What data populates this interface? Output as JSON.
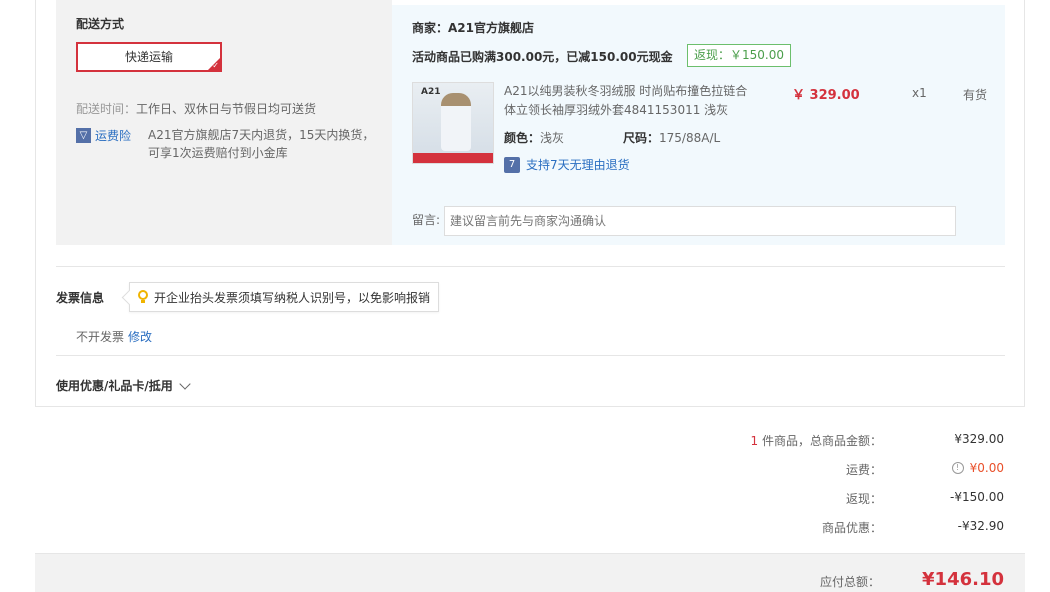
{
  "delivery": {
    "title": "配送方式",
    "method": "快递运输",
    "time_label": "配送时间：",
    "time_value": "工作日、双休日与节假日均可送货",
    "insurance_label": "运费险",
    "insurance_desc": "A21官方旗舰店7天内退货，15天内换货，可享1次运费赔付到小金库"
  },
  "shop": {
    "merchant": "商家：A21官方旗舰店",
    "promo": "活动商品已购满300.00元，已减150.00元现金",
    "rebate_badge": "返现：￥150.00",
    "product": {
      "thumb_brand": "A21",
      "title": "A21以纯男装秋冬羽绒服 时尚贴布撞色拉链合体立领长袖厚羽绒外套4841153011 浅灰",
      "price": "￥ 329.00",
      "qty": "x1",
      "stock": "有货",
      "color_label": "颜色：",
      "color_value": "浅灰",
      "size_label": "尺码：",
      "size_value": "175/88A/L",
      "return_icon": "7",
      "return_text": "支持7天无理由退货"
    },
    "note_label": "留言:",
    "note_placeholder": "建议留言前先与商家沟通确认"
  },
  "invoice": {
    "title": "发票信息",
    "tip": "开企业抬头发票须填写纳税人识别号，以免影响报销",
    "status": "不开发票",
    "edit": "修改"
  },
  "coupon": {
    "title": "使用优惠/礼品卡/抵用"
  },
  "summary": {
    "count": "1",
    "count_suffix": " 件商品，总商品金额：",
    "goods_total": "¥329.00",
    "freight_label": "运费：",
    "freight_value": "¥0.00",
    "rebate_label": "返现：",
    "rebate_value": "-¥150.00",
    "discount_label": "商品优惠：",
    "discount_value": "-¥32.90"
  },
  "footer": {
    "total_label": "应付总额：",
    "total_value": "¥146.10"
  },
  "colors": {
    "accent_red": "#d4323d",
    "link_blue": "#2a6ec1",
    "badge_green": "#4b9e4b"
  }
}
